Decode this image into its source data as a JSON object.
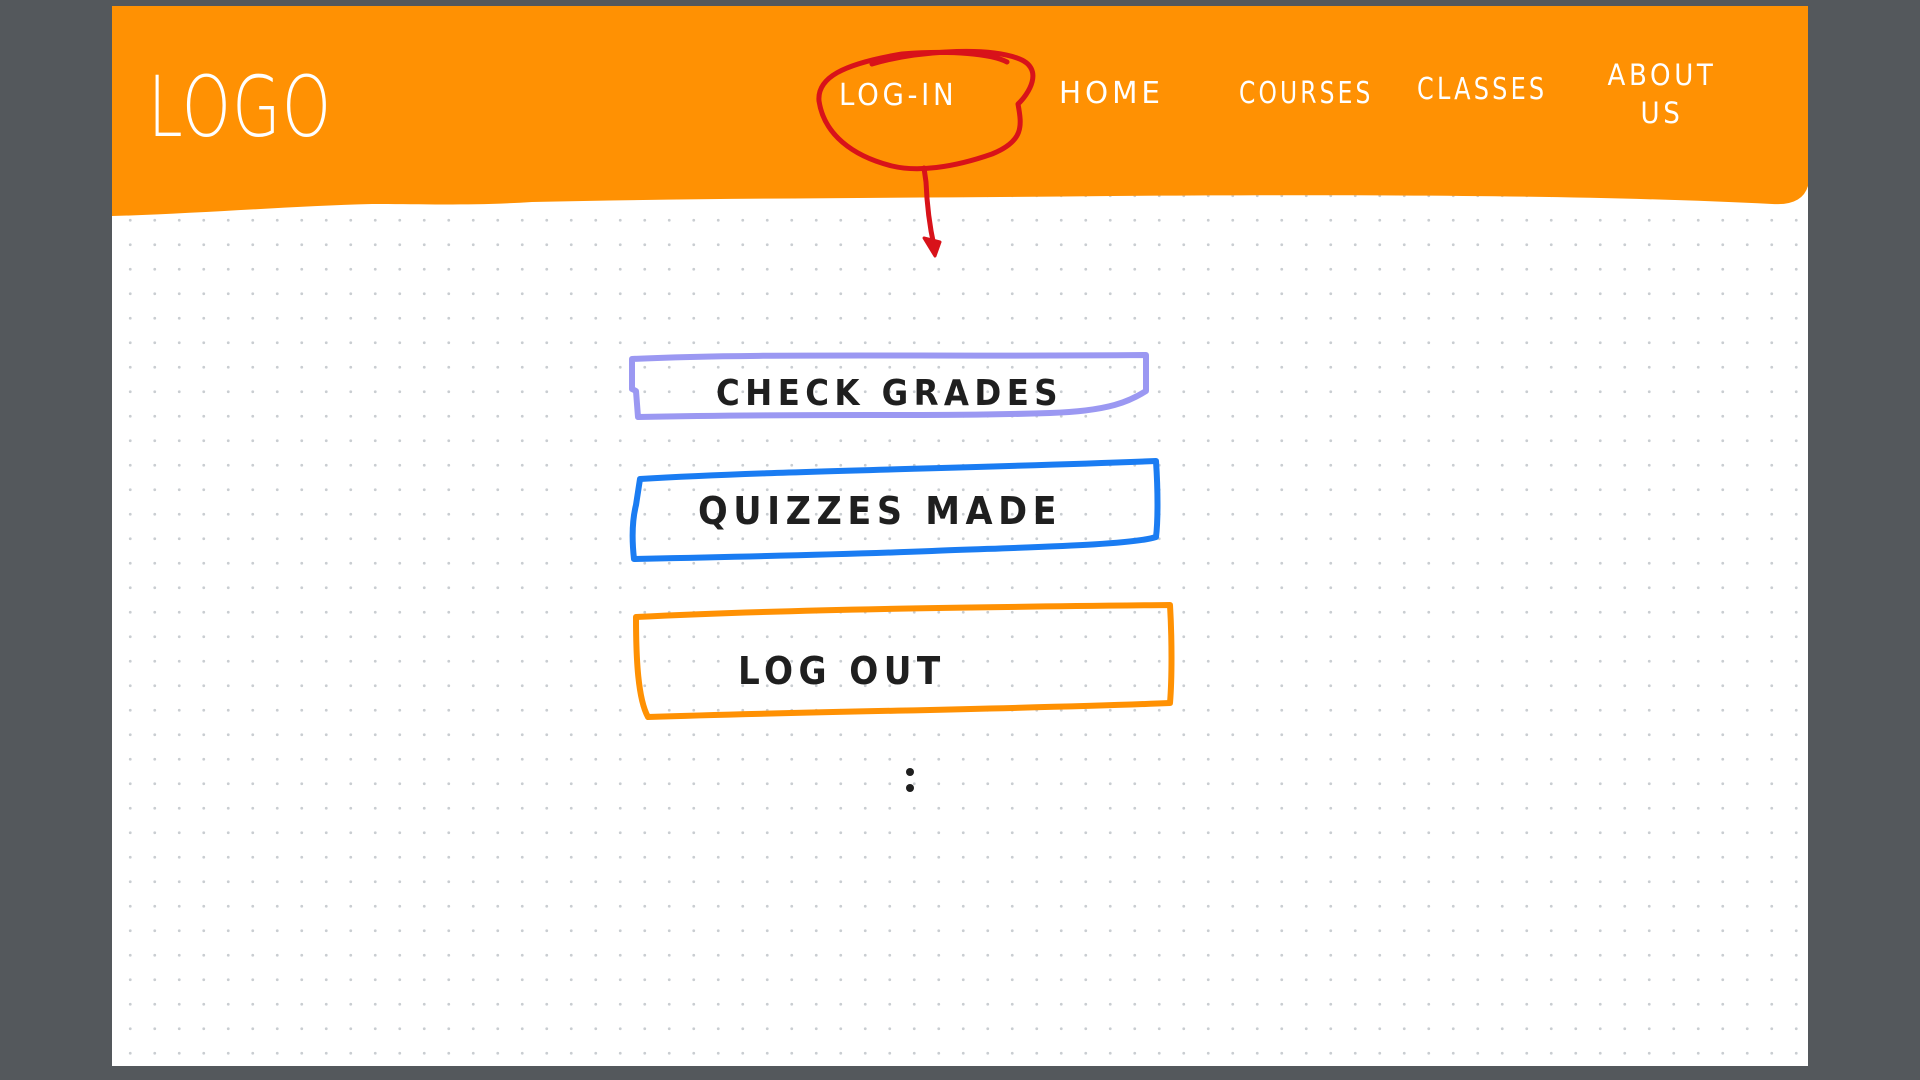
{
  "header": {
    "logo": "LOGO",
    "nav": {
      "login": "LOG-IN",
      "home": "HOME",
      "courses": "COURSES",
      "classes": "CLASSES",
      "about_line1": "ABOUT",
      "about_line2": "US"
    }
  },
  "menu": {
    "check_grades": "CHECK GRADES",
    "quizzes_made": "QUIZZES MADE",
    "log_out": "LOG OUT"
  },
  "colors": {
    "header_orange": "#ff9103",
    "annotation_red": "#d8121a",
    "check_grades_border": "#9b98f2",
    "quizzes_made_border": "#1a7cf2",
    "log_out_border": "#ff9103",
    "ink": "#1f1f1f"
  },
  "icons": {
    "annotation": "red-circle-with-arrow",
    "more": "vertical-dots"
  }
}
